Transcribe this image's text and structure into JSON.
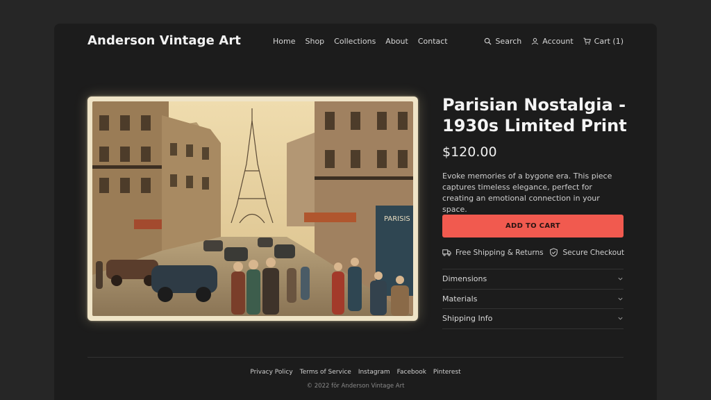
{
  "header": {
    "brand": "Anderson Vintage Art",
    "nav": [
      "Home",
      "Shop",
      "Collections",
      "About",
      "Contact"
    ],
    "search_label": "Search",
    "account_label": "Account",
    "cart_label": "Cart (1)"
  },
  "artwork": {
    "sign_text": "PARISIS"
  },
  "product": {
    "title": "Parisian Nostalgia - 1930s Limited Print",
    "price": "$120.00",
    "description": "Evoke memories of a bygone era. This piece captures timeless elegance, perfect for creating an emotional connection in your space.",
    "cta_label": "ADD TO CART",
    "perks": {
      "shipping": "Free Shipping & Returns",
      "secure": "Secure Checkout"
    },
    "accordion": [
      "Dimensions",
      "Materials",
      "Shipping Info"
    ]
  },
  "footer": {
    "links": [
      "Privacy Policy",
      "Terms of Service",
      "Instagram",
      "Facebook",
      "Pinterest"
    ],
    "copyright": "© 2022 för Anderson Vintage Art"
  },
  "colors": {
    "page_bg": "#262626",
    "card_bg": "#1c1c1c",
    "accent": "#f15a4f"
  }
}
